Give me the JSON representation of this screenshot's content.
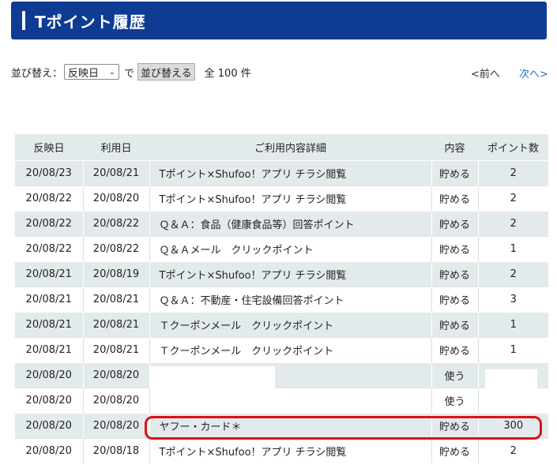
{
  "header": {
    "title": "Tポイント履歴"
  },
  "sortbar": {
    "sort_label": "並び替え：",
    "select_value": "反映日",
    "de": "で",
    "sort_button": "並び替える",
    "total": "全 100 件"
  },
  "pagination": {
    "prev": "<前へ",
    "next": "次へ>"
  },
  "table": {
    "headers": [
      "反映日",
      "利用日",
      "ご利用内容詳細",
      "内容",
      "ポイント数"
    ],
    "rows": [
      [
        "20/08/23",
        "20/08/21",
        "Tポイント×Shufoo！アプリ チラシ閲覧",
        "貯める",
        "2"
      ],
      [
        "20/08/22",
        "20/08/20",
        "Tポイント×Shufoo！アプリ チラシ閲覧",
        "貯める",
        "2"
      ],
      [
        "20/08/22",
        "20/08/22",
        "Ｑ＆Ａ：食品（健康食品等）回答ポイント",
        "貯める",
        "2"
      ],
      [
        "20/08/22",
        "20/08/22",
        "Ｑ＆Ａメール　クリックポイント",
        "貯める",
        "1"
      ],
      [
        "20/08/21",
        "20/08/19",
        "Tポイント×Shufoo！アプリ チラシ閲覧",
        "貯める",
        "2"
      ],
      [
        "20/08/21",
        "20/08/21",
        "Ｑ＆Ａ：不動産・住宅設備回答ポイント",
        "貯める",
        "3"
      ],
      [
        "20/08/21",
        "20/08/21",
        "Ｔクーポンメール　クリックポイント",
        "貯める",
        "1"
      ],
      [
        "20/08/21",
        "20/08/21",
        "Ｔクーポンメール　クリックポイント",
        "貯める",
        "1"
      ],
      [
        "20/08/20",
        "20/08/20",
        "",
        "使う",
        ""
      ],
      [
        "20/08/20",
        "20/08/20",
        "",
        "使う",
        ""
      ],
      [
        "20/08/20",
        "20/08/20",
        "ヤフー・カード＊",
        "貯める",
        "300"
      ],
      [
        "20/08/20",
        "20/08/18",
        "Tポイント×Shufoo！アプリ チラシ閲覧",
        "貯める",
        "2"
      ]
    ]
  },
  "colors": {
    "header_bg": "#0e3c94",
    "highlight": "#d9121b",
    "row_alt": "#e3eaeb",
    "link": "#2a6cc4"
  }
}
